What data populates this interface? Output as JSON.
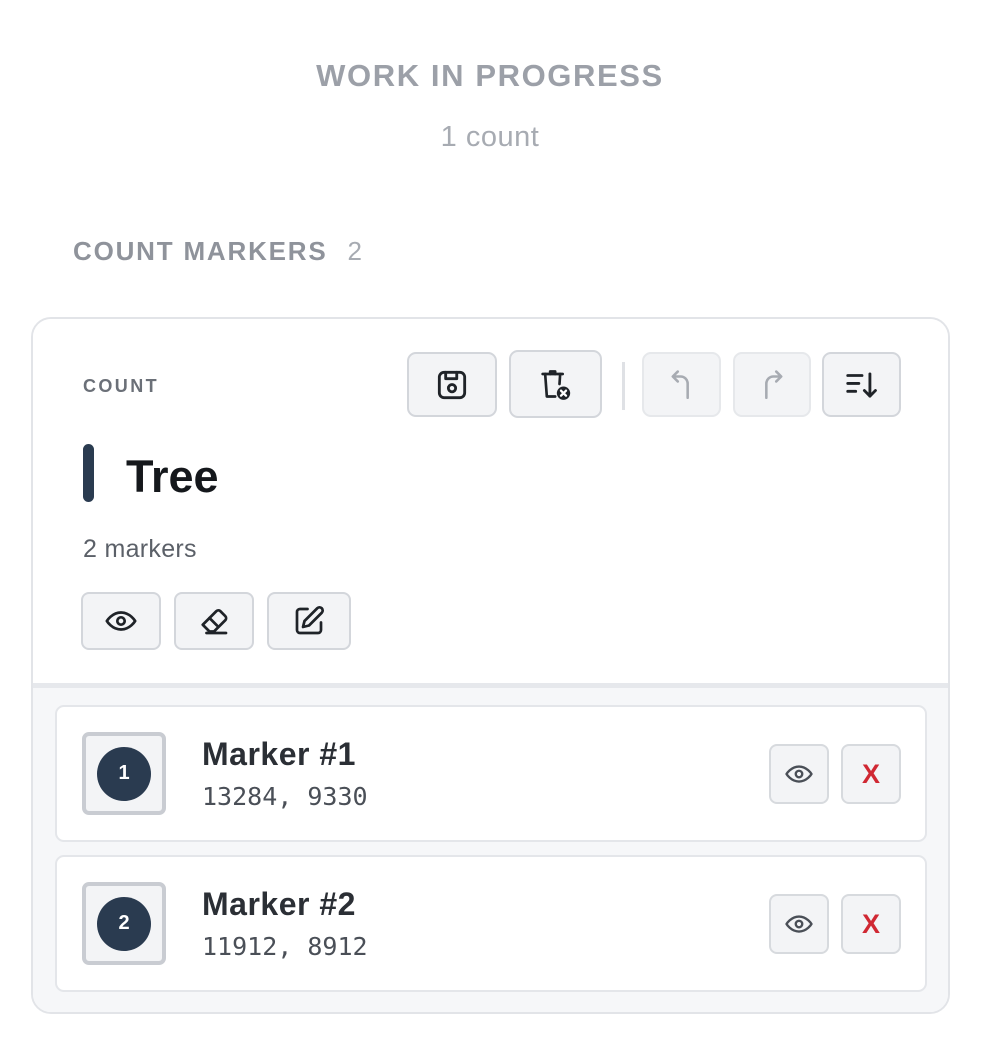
{
  "header": {
    "title": "WORK IN PROGRESS",
    "subtitle": "1 count"
  },
  "section": {
    "title": "COUNT MARKERS",
    "count": "2"
  },
  "count_card": {
    "label": "COUNT",
    "name": "Tree",
    "marker_count_text": "2 markers",
    "accent_color": "#2a3b50",
    "toolbar": [
      {
        "name": "save-button",
        "icon": "save-icon",
        "enabled": true
      },
      {
        "name": "delete-count-button",
        "icon": "trash-x-icon",
        "enabled": true
      },
      {
        "name": "undo-button",
        "icon": "undo-arrow-icon",
        "enabled": false
      },
      {
        "name": "redo-button",
        "icon": "redo-arrow-icon",
        "enabled": false
      },
      {
        "name": "sort-button",
        "icon": "sort-desc-icon",
        "enabled": true
      }
    ],
    "actions": [
      {
        "name": "toggle-visibility-button",
        "icon": "eye-icon"
      },
      {
        "name": "erase-button",
        "icon": "eraser-icon"
      },
      {
        "name": "edit-button",
        "icon": "pencil-square-icon"
      }
    ]
  },
  "markers": [
    {
      "index": "1",
      "title": "Marker #1",
      "coords": "13284, 9330",
      "delete_label": "X"
    },
    {
      "index": "2",
      "title": "Marker #2",
      "coords": "11912, 8912",
      "delete_label": "X"
    }
  ],
  "colors": {
    "danger": "#d02833",
    "muted_text": "#9ca0a8",
    "border": "#d3d6db"
  }
}
